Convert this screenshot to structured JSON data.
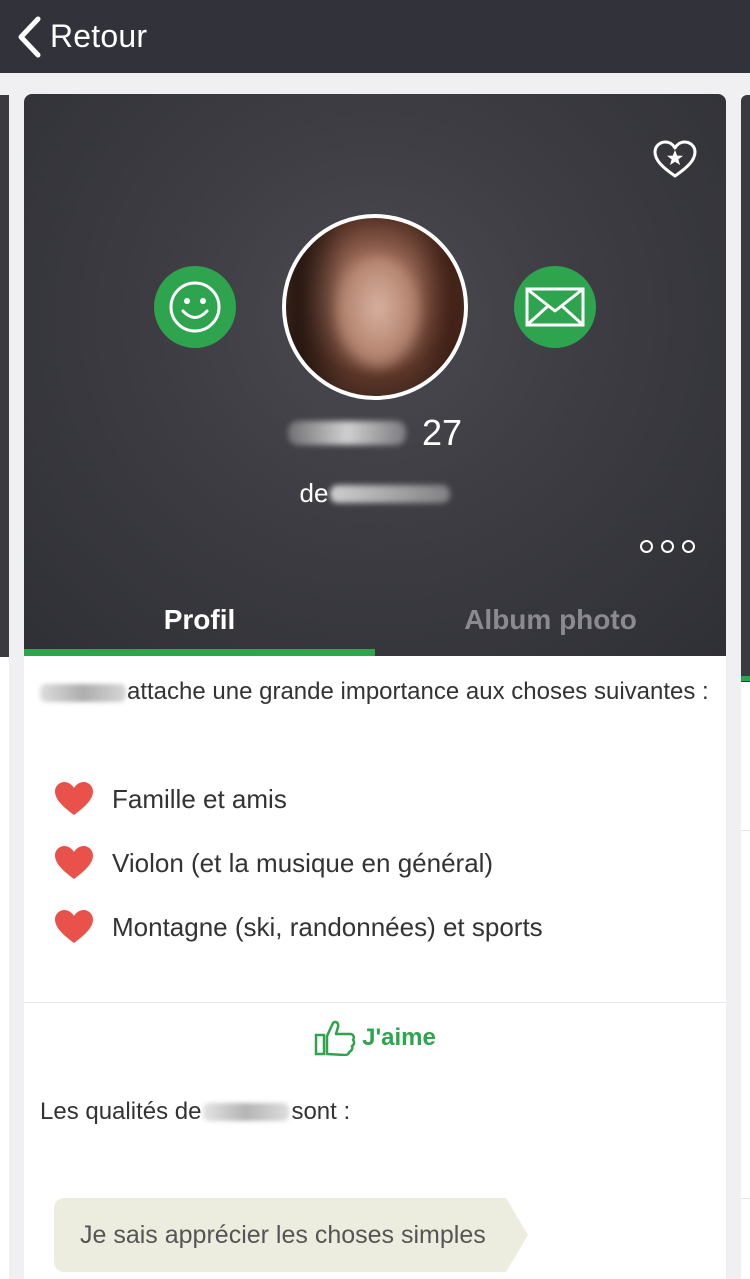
{
  "topbar": {
    "back_label": "Retour",
    "back_icon": "chevron-left-icon"
  },
  "header": {
    "age": "27",
    "city_prefix": "de",
    "favorite_icon": "heart-star-icon",
    "smile_icon": "smiley-icon",
    "message_icon": "envelope-icon",
    "more_icon": "more-dots-icon",
    "accent_color": "#2ea44f"
  },
  "tabs": [
    {
      "label": "Profil",
      "active": true
    },
    {
      "label": "Album photo",
      "active": false
    }
  ],
  "values_section": {
    "intro": "attache une grande importance aux choses suivantes :",
    "items": [
      {
        "label": "Famille et amis",
        "icon": "heart-icon"
      },
      {
        "label": "Violon (et la musique en général)",
        "icon": "heart-icon"
      },
      {
        "label": "Montagne (ski, randonnées) et sports",
        "icon": "heart-icon"
      }
    ]
  },
  "like": {
    "label": "J'aime",
    "icon": "thumbs-up-icon"
  },
  "qualities": {
    "prefix": "Les qualités de",
    "suffix": "sont :",
    "tags": [
      "Je sais apprécier les choses simples"
    ]
  }
}
